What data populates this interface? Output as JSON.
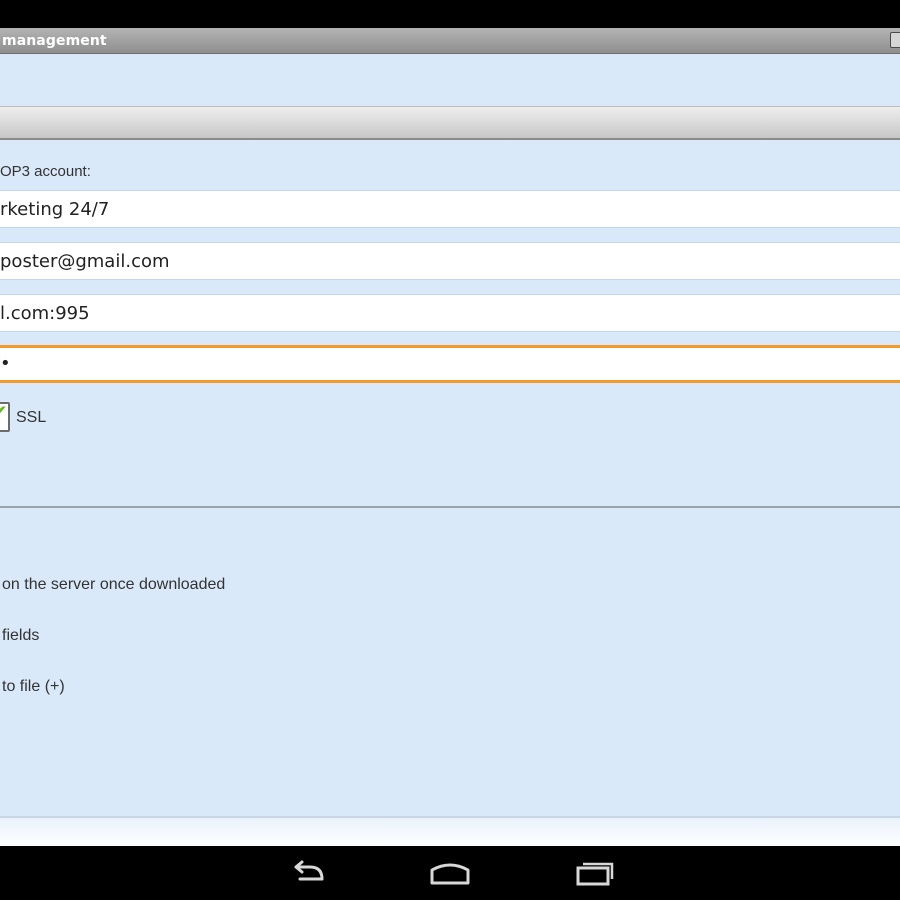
{
  "window": {
    "title": "management"
  },
  "form": {
    "section_label": "OP3 account:",
    "account_name": "rketing 24/7",
    "email": "poster@gmail.com",
    "server": "l.com:995",
    "password_mask": "•",
    "ssl_checked": true,
    "ssl_label": "SSL"
  },
  "options": {
    "delete_on_server": "on the server once downloaded",
    "fields": "fields",
    "to_file": "to file (+)"
  },
  "navbar": {
    "icons": [
      "back-icon",
      "home-icon",
      "recent-apps-icon"
    ]
  },
  "colors": {
    "background": "#dae9f9",
    "focus_accent": "#f39a2b",
    "check_green": "#5fbe1d"
  }
}
